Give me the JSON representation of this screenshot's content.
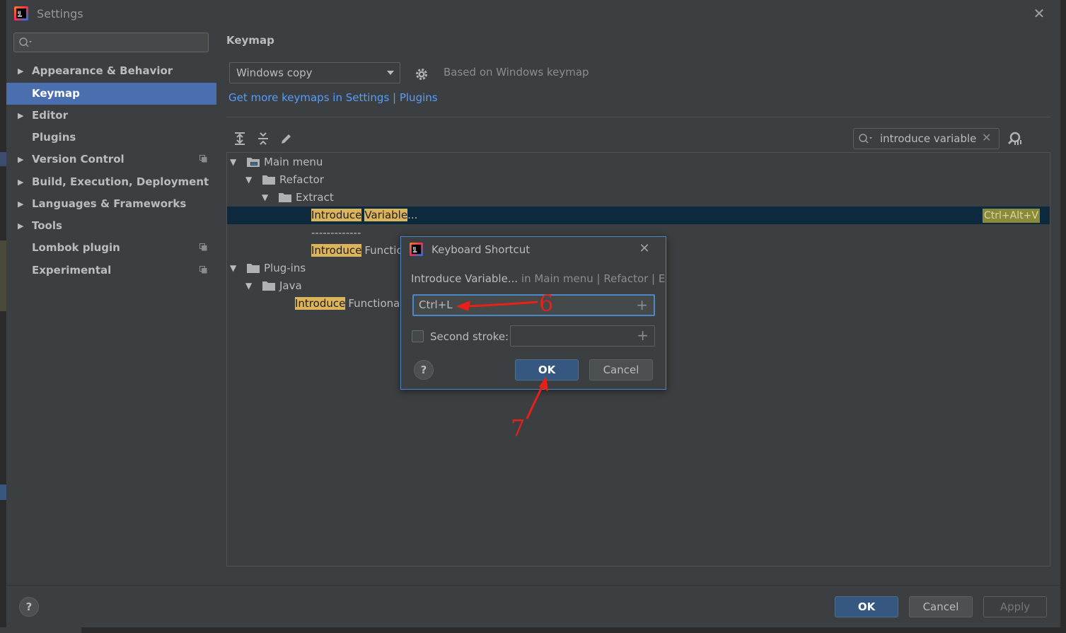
{
  "window": {
    "title": "Settings"
  },
  "sidebar": {
    "search_placeholder": "",
    "items": [
      {
        "label": "Appearance & Behavior",
        "expandable": true
      },
      {
        "label": "Keymap",
        "selected": true
      },
      {
        "label": "Editor",
        "expandable": true
      },
      {
        "label": "Plugins"
      },
      {
        "label": "Version Control",
        "expandable": true,
        "project_level": true
      },
      {
        "label": "Build, Execution, Deployment",
        "expandable": true
      },
      {
        "label": "Languages & Frameworks",
        "expandable": true
      },
      {
        "label": "Tools",
        "expandable": true
      },
      {
        "label": "Lombok plugin",
        "project_level": true
      },
      {
        "label": "Experimental",
        "project_level": true
      }
    ]
  },
  "keymap": {
    "heading": "Keymap",
    "selected_keymap": "Windows copy",
    "based_on": "Based on Windows keymap",
    "more_link": "Get more keymaps in Settings | Plugins",
    "filter_value": "introduce variable",
    "tree": {
      "main_menu": "Main menu",
      "refactor": "Refactor",
      "extract": "Extract",
      "hl_introduce": "Introduce",
      "hl_variable": "Variable",
      "ellipsis": "...",
      "separator": "-------------",
      "functional_partial": "Functic",
      "plugins": "Plug-ins",
      "java": "Java",
      "functional_partial2": "Functional",
      "shortcut": "Ctrl+Alt+V"
    }
  },
  "dialog": {
    "title": "Keyboard Shortcut",
    "action_name": "Introduce Variable...",
    "action_path": " in Main menu | Refactor | Extract",
    "first_stroke": "Ctrl+L",
    "second_stroke_label": "Second stroke:",
    "second_stroke_checked": false,
    "ok_label": "OK",
    "cancel_label": "Cancel",
    "help": "?"
  },
  "footer": {
    "help": "?",
    "ok_label": "OK",
    "cancel_label": "Cancel",
    "apply_label": "Apply"
  },
  "annotations": {
    "step6": "6",
    "step7": "7"
  },
  "colors": {
    "accent": "#4b6eaf",
    "highlight": "#dcb55a",
    "annotation": "#e8201a",
    "link": "#589df6"
  }
}
